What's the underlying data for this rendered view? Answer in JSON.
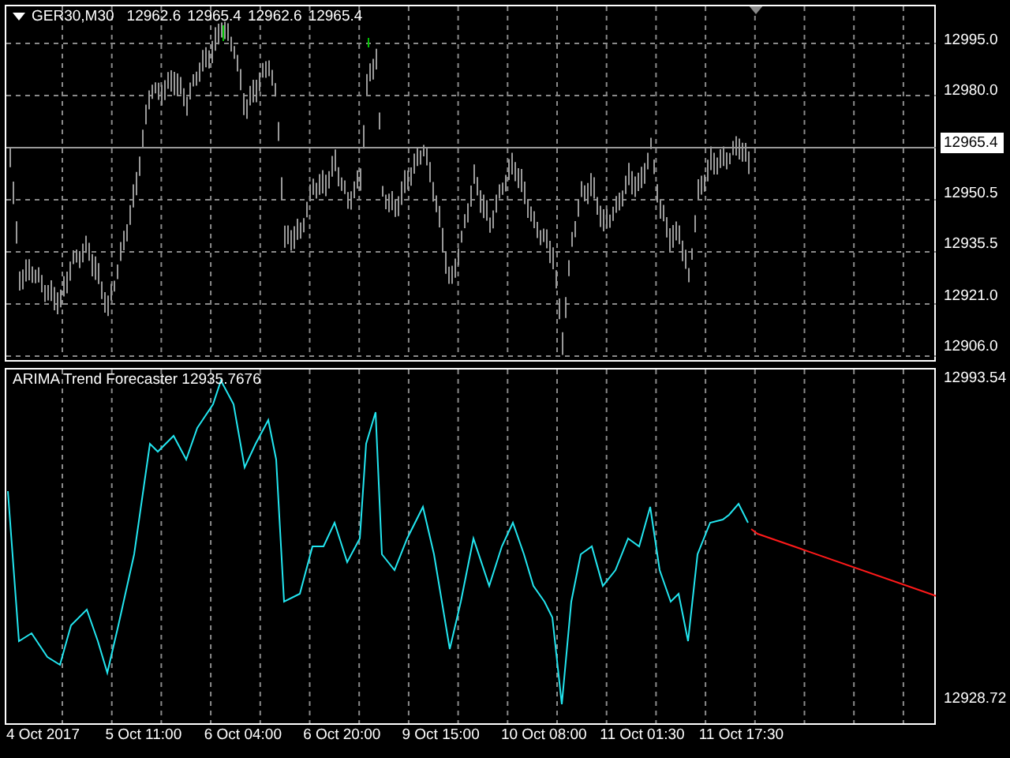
{
  "main_chart": {
    "title": "GER30,M30",
    "ohlc": [
      "12962.6",
      "12965.4",
      "12962.6",
      "12965.4"
    ],
    "price_axis": [
      {
        "label": "12995.0",
        "current": false
      },
      {
        "label": "12980.0",
        "current": false
      },
      {
        "label": "12965.4",
        "current": true
      },
      {
        "label": "12950.5",
        "current": false
      },
      {
        "label": "12935.5",
        "current": false
      },
      {
        "label": "12921.0",
        "current": false
      },
      {
        "label": "12906.0",
        "current": false
      }
    ]
  },
  "indicator": {
    "title": "ARIMA Trend Forecaster 12935.7676",
    "axis": [
      "12993.54",
      "12928.72"
    ]
  },
  "time_axis": [
    "4 Oct 2017",
    "5 Oct 11:00",
    "6 Oct 04:00",
    "6 Oct 20:00",
    "9 Oct 15:00",
    "10 Oct 08:00",
    "11 Oct 01:30",
    "11 Oct 17:30"
  ]
}
